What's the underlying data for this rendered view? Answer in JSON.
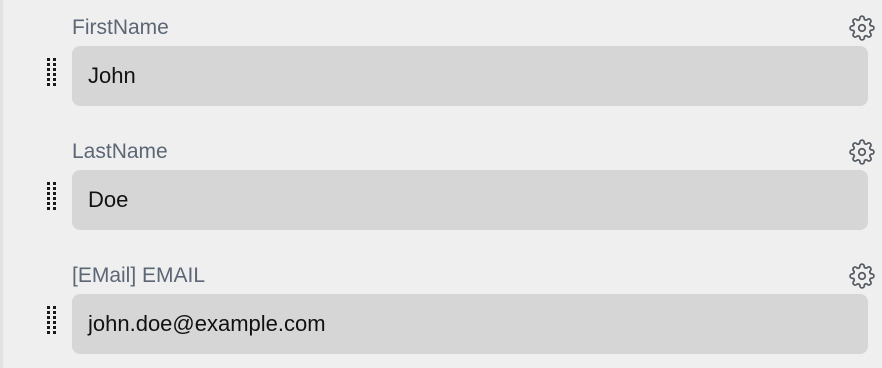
{
  "fields": [
    {
      "label": "FirstName",
      "value": "John",
      "settings_icon": "gear-icon",
      "drag_icon": "drag-handle-icon"
    },
    {
      "label": "LastName",
      "value": "Doe",
      "settings_icon": "gear-icon",
      "drag_icon": "drag-handle-icon"
    },
    {
      "label": "[EMail] EMAIL",
      "value": "john.doe@example.com",
      "settings_icon": "gear-icon",
      "drag_icon": "drag-handle-icon"
    }
  ],
  "colors": {
    "background": "#efefef",
    "label": "#5c6675",
    "input_background": "#d6d6d6",
    "input_text": "#111111",
    "icon": "#555b63"
  }
}
